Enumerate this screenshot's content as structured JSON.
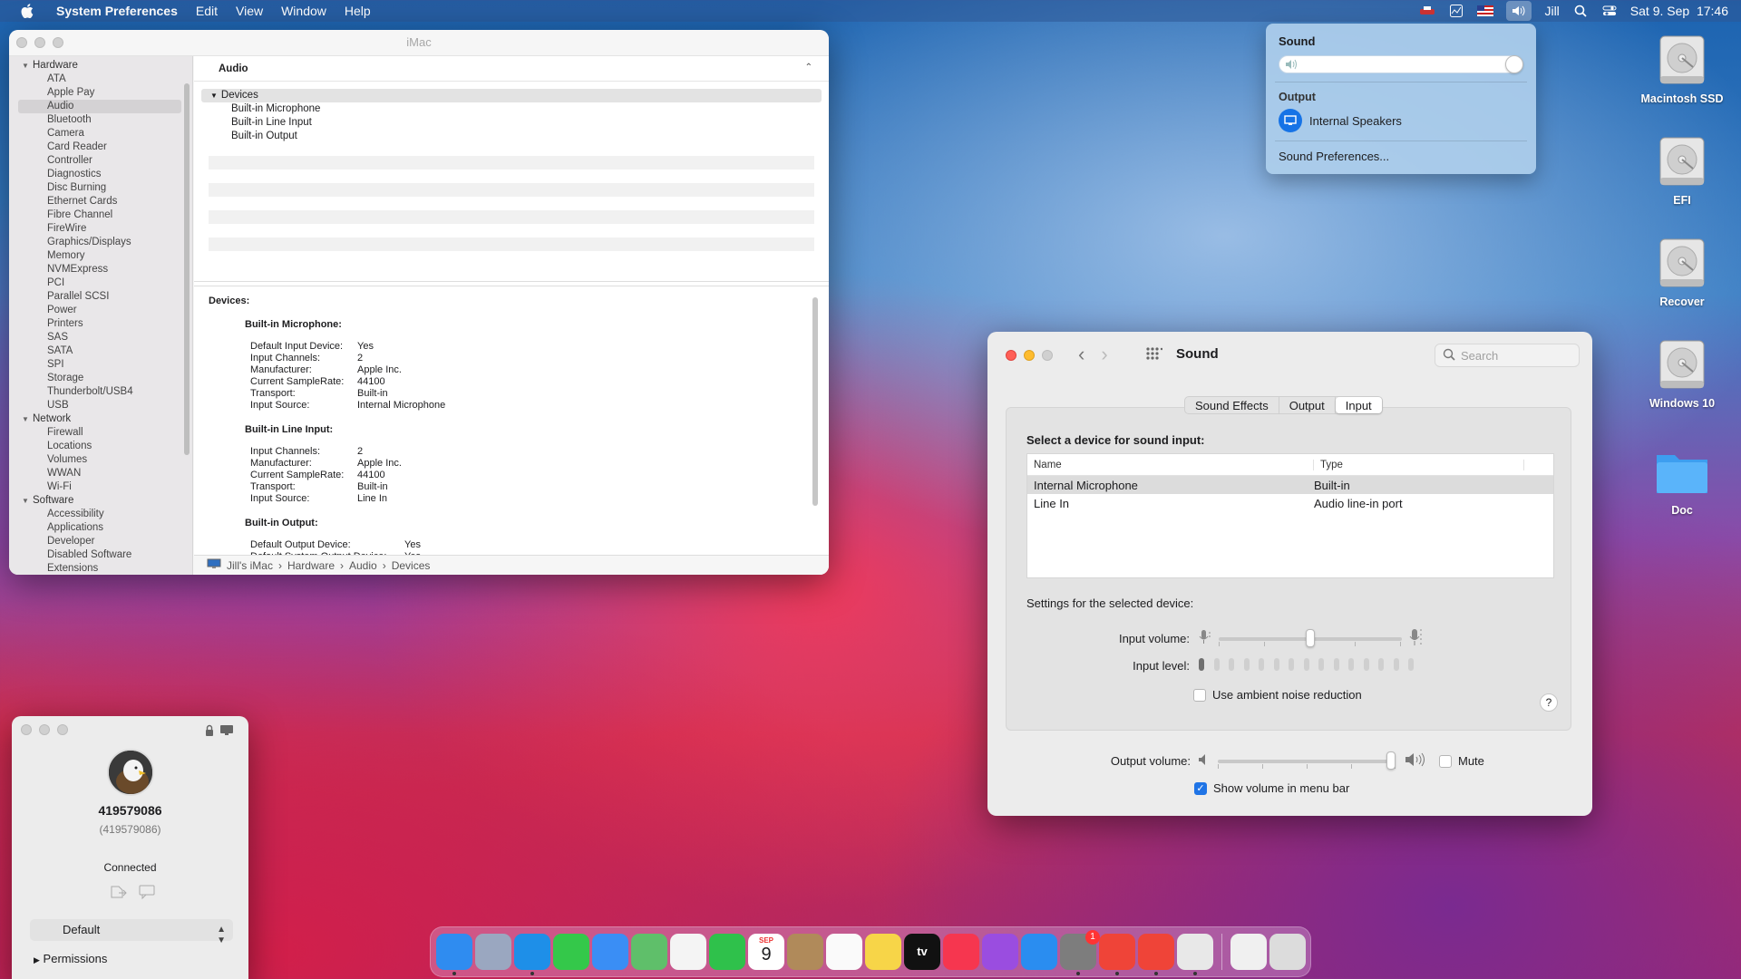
{
  "menubar": {
    "apple_icon": "apple-logo",
    "app_name": "System Preferences",
    "items": [
      "Edit",
      "View",
      "Window",
      "Help"
    ],
    "status_icons": [
      "network-activity-icon",
      "activity-chart-icon",
      "us-flag-input-icon",
      "volume-icon"
    ],
    "user": "Jill",
    "datetime": "Sat 9. Sep  17:46"
  },
  "sysinfo": {
    "title": "iMac",
    "sidebar": [
      {
        "type": "group",
        "label": "Hardware"
      },
      {
        "type": "item",
        "label": "ATA"
      },
      {
        "type": "item",
        "label": "Apple Pay"
      },
      {
        "type": "item",
        "label": "Audio",
        "selected": true
      },
      {
        "type": "item",
        "label": "Bluetooth"
      },
      {
        "type": "item",
        "label": "Camera"
      },
      {
        "type": "item",
        "label": "Card Reader"
      },
      {
        "type": "item",
        "label": "Controller"
      },
      {
        "type": "item",
        "label": "Diagnostics"
      },
      {
        "type": "item",
        "label": "Disc Burning"
      },
      {
        "type": "item",
        "label": "Ethernet Cards"
      },
      {
        "type": "item",
        "label": "Fibre Channel"
      },
      {
        "type": "item",
        "label": "FireWire"
      },
      {
        "type": "item",
        "label": "Graphics/Displays"
      },
      {
        "type": "item",
        "label": "Memory"
      },
      {
        "type": "item",
        "label": "NVMExpress"
      },
      {
        "type": "item",
        "label": "PCI"
      },
      {
        "type": "item",
        "label": "Parallel SCSI"
      },
      {
        "type": "item",
        "label": "Power"
      },
      {
        "type": "item",
        "label": "Printers"
      },
      {
        "type": "item",
        "label": "SAS"
      },
      {
        "type": "item",
        "label": "SATA"
      },
      {
        "type": "item",
        "label": "SPI"
      },
      {
        "type": "item",
        "label": "Storage"
      },
      {
        "type": "item",
        "label": "Thunderbolt/USB4"
      },
      {
        "type": "item",
        "label": "USB"
      },
      {
        "type": "group",
        "label": "Network"
      },
      {
        "type": "item",
        "label": "Firewall"
      },
      {
        "type": "item",
        "label": "Locations"
      },
      {
        "type": "item",
        "label": "Volumes"
      },
      {
        "type": "item",
        "label": "WWAN"
      },
      {
        "type": "item",
        "label": "Wi-Fi"
      },
      {
        "type": "group",
        "label": "Software"
      },
      {
        "type": "item",
        "label": "Accessibility"
      },
      {
        "type": "item",
        "label": "Applications"
      },
      {
        "type": "item",
        "label": "Developer"
      },
      {
        "type": "item",
        "label": "Disabled Software"
      },
      {
        "type": "item",
        "label": "Extensions"
      }
    ],
    "header": "Audio",
    "tree": {
      "root": "Devices",
      "children": [
        "Built-in Microphone",
        "Built-in Line Input",
        "Built-in Output"
      ]
    },
    "detail": {
      "heading": "Devices:",
      "sections": [
        {
          "title": "Built-in Microphone:",
          "rows": [
            [
              "Default Input Device:",
              "Yes"
            ],
            [
              "Input Channels:",
              "2"
            ],
            [
              "Manufacturer:",
              "Apple Inc."
            ],
            [
              "Current SampleRate:",
              "44100"
            ],
            [
              "Transport:",
              "Built-in"
            ],
            [
              "Input Source:",
              "Internal Microphone"
            ]
          ]
        },
        {
          "title": "Built-in Line Input:",
          "rows": [
            [
              "Input Channels:",
              "2"
            ],
            [
              "Manufacturer:",
              "Apple Inc."
            ],
            [
              "Current SampleRate:",
              "44100"
            ],
            [
              "Transport:",
              "Built-in"
            ],
            [
              "Input Source:",
              "Line In"
            ]
          ]
        },
        {
          "title": "Built-in Output:",
          "wide": true,
          "rows": [
            [
              "Default Output Device:",
              "Yes"
            ],
            [
              "Default System Output Device:",
              "Yes"
            ]
          ]
        }
      ]
    },
    "breadcrumb": [
      "Jill's iMac",
      "Hardware",
      "Audio",
      "Devices"
    ]
  },
  "sound_menu": {
    "title": "Sound",
    "volume_level": 1.0,
    "output_label": "Output",
    "device": "Internal Speakers",
    "prefs_link": "Sound Preferences..."
  },
  "desktop_icons": [
    "Macintosh SSD",
    "EFI",
    "Recover",
    "Windows 10",
    "Doc"
  ],
  "sound_prefs": {
    "title": "Sound",
    "search_placeholder": "Search",
    "tabs": [
      "Sound Effects",
      "Output",
      "Input"
    ],
    "active_tab": "Input",
    "select_label": "Select a device for sound input:",
    "columns": [
      "Name",
      "Type"
    ],
    "rows": [
      {
        "name": "Internal Microphone",
        "type": "Built-in",
        "selected": true
      },
      {
        "name": "Line In",
        "type": "Audio line-in port"
      }
    ],
    "settings_label": "Settings for the selected device:",
    "input_volume_label": "Input volume:",
    "input_volume": 0.5,
    "input_level_label": "Input level:",
    "input_level_segments": 15,
    "input_level_active": 1,
    "ambient_label": "Use ambient noise reduction",
    "ambient_checked": false,
    "help": "?",
    "output_volume_label": "Output volume:",
    "output_volume": 1.0,
    "mute_label": "Mute",
    "mute_checked": false,
    "show_volume_label": "Show volume in menu bar",
    "show_volume_checked": true
  },
  "user_panel": {
    "id": "419579086",
    "id_sub": "(419579086)",
    "status": "Connected",
    "dropdown": "Default",
    "permissions": "Permissions"
  },
  "dock": {
    "apps": [
      {
        "name": "finder",
        "color": "#2f8cf0",
        "running": true
      },
      {
        "name": "launchpad",
        "color": "#9aa7c0"
      },
      {
        "name": "safari",
        "color": "#1e8fe8",
        "running": true
      },
      {
        "name": "messages",
        "color": "#34c84a"
      },
      {
        "name": "mail",
        "color": "#3a8ef5"
      },
      {
        "name": "maps",
        "color": "#5fbf6a"
      },
      {
        "name": "photos",
        "color": "#f4f4f4"
      },
      {
        "name": "facetime",
        "color": "#2fc14b"
      },
      {
        "name": "calendar",
        "color": "#ffffff"
      },
      {
        "name": "contacts",
        "color": "#b08a5a"
      },
      {
        "name": "reminders",
        "color": "#fafafa"
      },
      {
        "name": "notes",
        "color": "#f7d548"
      },
      {
        "name": "tv",
        "color": "#111111"
      },
      {
        "name": "music",
        "color": "#f6364f"
      },
      {
        "name": "podcasts",
        "color": "#9a4de0"
      },
      {
        "name": "app-store",
        "color": "#2a8df0"
      },
      {
        "name": "system-preferences",
        "color": "#7d7d7d",
        "running": true,
        "badge": "1"
      },
      {
        "name": "anydesk",
        "color": "#ef4438",
        "running": true
      },
      {
        "name": "anydesk-2",
        "color": "#ef4438",
        "running": true
      },
      {
        "name": "system-information",
        "color": "#e8e8e8",
        "running": true
      }
    ],
    "calendar_month": "SEP",
    "calendar_day": "9",
    "tv_label": "tv",
    "others": [
      {
        "name": "documents",
        "color": "#f0f0f0"
      },
      {
        "name": "trash",
        "color": "#dcdcdc"
      }
    ]
  }
}
